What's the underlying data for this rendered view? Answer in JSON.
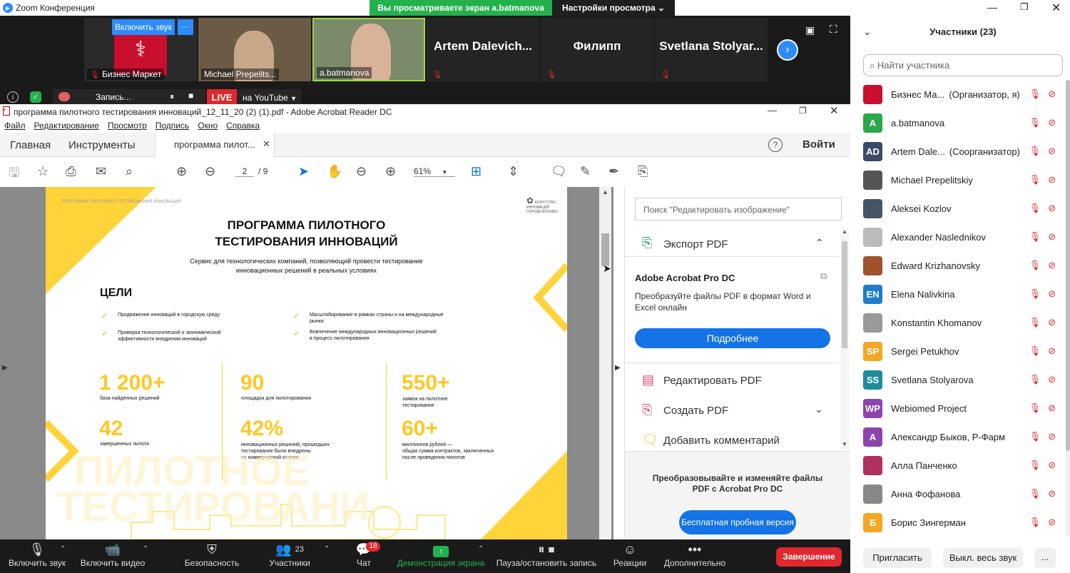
{
  "zoom": {
    "title": "Zoom Конференция",
    "viewing": "Вы просматриваете экран a.batmanova",
    "view_settings": "Настройки просмотра"
  },
  "strip": {
    "unmute_btn": "Включить звук",
    "more": "···",
    "tiles": [
      {
        "name": "Бизнес Маркет"
      },
      {
        "name": "Michael Prepelits..."
      },
      {
        "name": "a.batmanova"
      },
      {
        "name": "Artem  Dalevich..."
      },
      {
        "name": "Филипп"
      },
      {
        "name": "Svetlana  Stolyar..."
      }
    ],
    "recording": "Запись...",
    "live": "LIVE",
    "youtube": "на YouTube"
  },
  "acrobat": {
    "title": "программа пилотного тестирования инноваций_12_11_20 (2) (1).pdf - Adobe Acrobat Reader DC",
    "menu": [
      "Файл",
      "Редактирование",
      "Просмотр",
      "Подпись",
      "Окно",
      "Справка"
    ],
    "tabs": {
      "home": "Главная",
      "tools": "Инструменты",
      "doc": "программа пилот..."
    },
    "signin": "Войти",
    "page_cur": "2",
    "page_total": "/ 9",
    "zoom": "61%",
    "search_placeholder": "Поиск \"Редактировать изображение\"",
    "export": "Экспорт PDF",
    "promo_title": "Adobe Acrobat Pro DC",
    "promo_text": "Преобразуйте файлы PDF в формат Word и Excel онлайн",
    "more_btn": "Подробнее",
    "edit_pdf": "Редактировать PDF",
    "create_pdf": "Создать PDF",
    "add_comment": "Добавить комментарий",
    "bottom_promo": "Преобразовывайте и изменяйте файлы PDF с Acrobat Pro DC",
    "trial": "Бесплатная пробная версия"
  },
  "doc": {
    "header_small": "ПРОГРАММА ПИЛОТНОГО ТЕСТИРОВАНИЯ ИННОВАЦИЙ",
    "logo_text": "АГЕНТСТВО ИННОВАЦИЙ ГОРОДА МОСКВЫ",
    "title1": "ПРОГРАММА ПИЛОТНОГО",
    "title2": "ТЕСТИРОВАНИЯ ИННОВАЦИЙ",
    "sub1": "Сервис для технологических  компаний, позволяющий  провести тестирование",
    "sub2": "инновационных решений в реальных условиях",
    "goals": "ЦЕЛИ",
    "g1": "Продвижение инноваций  в городскую среду",
    "g2a": "Проверка технологической и экономической",
    "g2b": "эффективности внедрения инноваций",
    "g3a": "Масштабирование в рамках страны и на международные",
    "g3b": "рынки",
    "g4a": "Вовлечение международных инновационных решений",
    "g4b": "в процесс пилотирования",
    "s1": "1 200+",
    "s1l": "база найденных  решений",
    "s2": "90",
    "s2l": "площадок для  пилотирования",
    "s3": "550+",
    "s3a": "заявок на пилотное",
    "s3b": "тестирование",
    "s4": "42",
    "s4l": "завершенных пилота",
    "s5": "42%",
    "s5a": "инновационных решений,  прошедших",
    "s5b": "тестирование  были внедрены",
    "s5c": "на коммерческой основе",
    "s6": "60+",
    "s6a": "миллионов рублей —",
    "s6b": "общая сумма контрактов, заключенных",
    "s6c": "после проведения пилотов",
    "wm1": "ПИЛОТНОЕ",
    "wm2": "ТЕСТИРОВАНИ"
  },
  "participants": {
    "header": "Участники (23)",
    "search_placeholder": "Найти участника",
    "list": [
      {
        "name": "Бизнес Ма...",
        "role": "(Организатор, я)",
        "av": "",
        "color": "#c8102e"
      },
      {
        "name": "a.batmanova",
        "role": "",
        "av": "A",
        "color": "#2ba84a"
      },
      {
        "name": "Artem Dale...",
        "role": "(Соорганизатор)",
        "av": "AD",
        "color": "#3a4a6b"
      },
      {
        "name": "Michael Prepelitskiy",
        "role": "",
        "av": "",
        "color": "#555"
      },
      {
        "name": "Aleksei Kozlov",
        "role": "",
        "av": "",
        "color": "#445566"
      },
      {
        "name": "Alexander Naslednikov",
        "role": "",
        "av": "",
        "color": "#bbb"
      },
      {
        "name": "Edward Krizhanovsky",
        "role": "",
        "av": "",
        "color": "#a0522d"
      },
      {
        "name": "Elena Nalivkina",
        "role": "",
        "av": "EN",
        "color": "#1e7ec8"
      },
      {
        "name": "Konstantin Khomanov",
        "role": "",
        "av": "",
        "color": "#999"
      },
      {
        "name": "Sergei Petukhov",
        "role": "",
        "av": "SP",
        "color": "#f5a623"
      },
      {
        "name": "Svetlana Stolyarova",
        "role": "",
        "av": "SS",
        "color": "#1e8c9e"
      },
      {
        "name": "Webiomed Project",
        "role": "",
        "av": "WP",
        "color": "#8e44ad"
      },
      {
        "name": "Александр Быков, Р-Фарм",
        "role": "",
        "av": "А",
        "color": "#8e44ad"
      },
      {
        "name": "Алла Панченко",
        "role": "",
        "av": "",
        "color": "#b03060"
      },
      {
        "name": "Анна Фофанова",
        "role": "",
        "av": "",
        "color": "#888"
      },
      {
        "name": "Борис Зингерман",
        "role": "",
        "av": "Б",
        "color": "#f5a623"
      }
    ],
    "invite": "Пригласить",
    "mute_all": "Выкл. весь звук",
    "more": "..."
  },
  "bottombar": {
    "audio": "Включить звук",
    "video": "Включить видео",
    "security": "Безопасность",
    "participants": "Участники",
    "participants_count": "23",
    "chat": "Чат",
    "chat_badge": "18",
    "share": "Демонстрация экрана",
    "pause": "Пауза/остановить запись",
    "reactions": "Реакции",
    "more": "Дополнительно",
    "end": "Завершение"
  }
}
